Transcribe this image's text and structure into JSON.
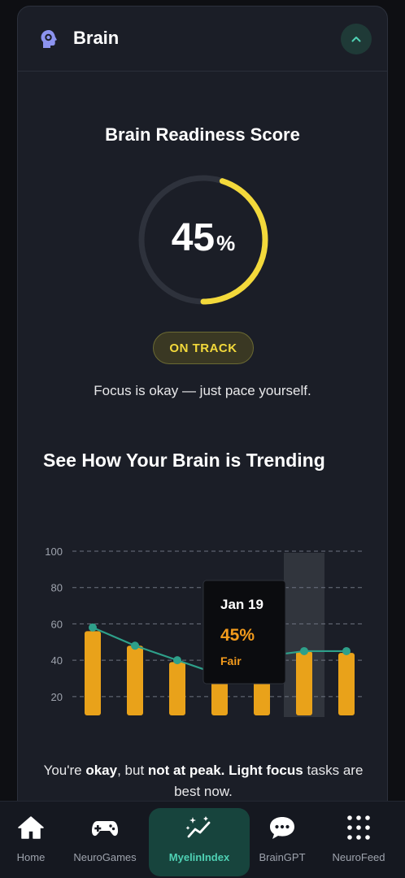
{
  "card": {
    "title": "Brain",
    "icon": "brain-gear-icon",
    "collapse_icon": "chevron-up-icon"
  },
  "score": {
    "title": "Brain Readiness Score",
    "value": "45",
    "unit": "%",
    "fraction": 0.45,
    "status": "ON TRACK",
    "message": "Focus is okay — just pace yourself.",
    "accent": "#f3d93b"
  },
  "trend": {
    "title": "See How Your Brain is Trending",
    "tooltip": {
      "date": "Jan 19",
      "value": "45%",
      "label": "Fair"
    }
  },
  "chart_data": {
    "type": "bar",
    "title": "See How Your Brain is Trending",
    "y_ticks": [
      "100",
      "80",
      "60",
      "40",
      "20"
    ],
    "ylim": [
      15,
      100
    ],
    "bars": [
      56,
      48,
      39,
      32,
      40,
      45,
      44
    ],
    "line": [
      58,
      48,
      40,
      32,
      42,
      45,
      45
    ],
    "highlight_index": 5,
    "grid": true,
    "bar_color": "#e9a21a",
    "line_color": "#2ea08a"
  },
  "summary": {
    "p1": "You're ",
    "b1": "okay",
    "p2": ", but ",
    "b2": "not at peak.",
    "p3": " ",
    "b3": "Light focus",
    "p4": " tasks are best now."
  },
  "nav": {
    "items": [
      {
        "label": "Home",
        "icon": "home-icon"
      },
      {
        "label": "NeuroGames",
        "icon": "gamepad-icon"
      },
      {
        "label": "MyelinIndex",
        "icon": "trend-sparkle-icon"
      },
      {
        "label": "BrainGPT",
        "icon": "chat-bubble-icon"
      },
      {
        "label": "NeuroFeed",
        "icon": "grid-dots-icon"
      }
    ],
    "active": "MyelinIndex"
  }
}
